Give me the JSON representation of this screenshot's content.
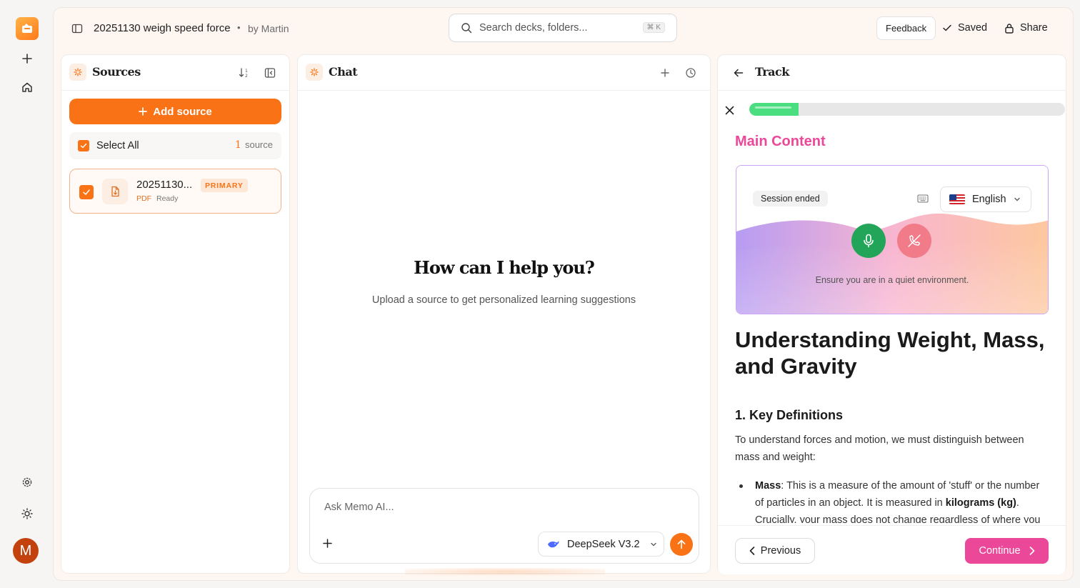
{
  "rail": {
    "avatar_initial": "M"
  },
  "topbar": {
    "doc_title": "20251130 weigh speed force",
    "separator": "•",
    "byline": "by Martin",
    "search_placeholder": "Search decks, folders...",
    "search_shortcut": "⌘ K",
    "feedback_label": "Feedback",
    "saved_label": "Saved",
    "share_label": "Share"
  },
  "sources": {
    "title": "Sources",
    "add_label": "Add source",
    "select_all_label": "Select All",
    "count": "1",
    "count_unit": "source",
    "items": [
      {
        "name": "20251130...",
        "badge": "PRIMARY",
        "type": "PDF",
        "status": "Ready"
      }
    ]
  },
  "chat": {
    "title": "Chat",
    "greeting": "How can I help you?",
    "subtitle": "Upload a source to get personalized learning suggestions",
    "input_placeholder": "Ask Memo AI...",
    "model": "DeepSeek V3.2"
  },
  "track": {
    "title": "Track",
    "progress_fraction": 0.155,
    "section_label": "Main Content",
    "voice": {
      "session_status": "Session ended",
      "language": "English",
      "hint": "Ensure you are in a quiet environment."
    },
    "heading": "Understanding Weight, Mass, and Gravity",
    "subheading": "1. Key Definitions",
    "paragraph": "To understand forces and motion, we must distinguish between mass and weight:",
    "bullet_term": "Mass",
    "bullet_text_1": ": This is a measure of the amount of 'stuff' or the number of particles in an object. It is measured in ",
    "bullet_unit": "kilograms (kg)",
    "bullet_text_2": ". Crucially, your mass does not change regardless of where you are in the universe.",
    "prev_label": "Previous",
    "continue_label": "Continue"
  },
  "colors": {
    "accent_orange": "#f97316",
    "accent_pink": "#ec4899",
    "progress_green": "#4ade80",
    "mic_green": "#22a559",
    "end_call_red": "#f27b8a"
  }
}
